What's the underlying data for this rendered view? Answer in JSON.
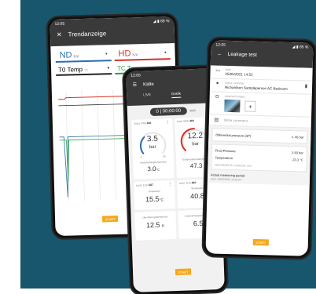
{
  "colors": {
    "background_panel": "#17566d",
    "accent_orange": "#f6a81c",
    "appbar_dark": "#3a3a3a",
    "nd_blue": "#2b6cb0",
    "hd_red": "#d93025",
    "tc_green": "#25a244"
  },
  "phone1": {
    "status_time": "12:05",
    "status_icons": "◢ ▮ 85 %",
    "close_icon": "✕",
    "title": "Trendanzeige",
    "selectors": [
      {
        "name": "ND",
        "unit": "bar",
        "arrow": "▾"
      },
      {
        "name": "HD",
        "unit": "bar",
        "arrow": "▾"
      }
    ],
    "selectors2": [
      {
        "name": "T0 Temp",
        "unit": "°C",
        "arrow": "▾"
      },
      {
        "name": "TC T",
        "unit": "",
        "arrow": ""
      }
    ],
    "start_label": "START"
  },
  "phone2": {
    "status_time": "12:05",
    "menu_icon": "☰",
    "title": "Kälte",
    "tabs": [
      "LIVE",
      "Grafik",
      ""
    ],
    "timer": "0 | 00:00:00",
    "timer_unit": "Std:h",
    "cards_gauge": [
      {
        "header": "testo 549i",
        "id": "460",
        "value": "3.5",
        "unit": "bar",
        "min": "0",
        "max": "50",
        "caption": "Verdampfungstemperatur",
        "temp": "3.0",
        "temp_unit": "°C",
        "menu": "⋮"
      },
      {
        "header": "testo 549i",
        "id": "460",
        "value": "12.2",
        "unit": "bar",
        "min": "",
        "max": "",
        "caption": "Kondensationstemperatur",
        "temp": "47.3",
        "temp_unit": "",
        "menu": ""
      }
    ],
    "cards_small_hdr": [
      {
        "header": "testo 115i",
        "id": "687",
        "menu": "⋮"
      },
      {
        "header": "testo 115i",
        "id": "460",
        "menu": ""
      }
    ],
    "cards_vals": [
      {
        "caption": "Temperatur",
        "value": "15.5",
        "unit": "°C"
      },
      {
        "caption": "Temperatur",
        "value": "40.8",
        "unit": ""
      },
      {
        "caption": "Überhitzungstemperatur",
        "value": "12.5",
        "unit": "K"
      },
      {
        "caption": "Unterkühlungstemperatur",
        "value": "6.5",
        "unit": ""
      }
    ],
    "start_label": "START"
  },
  "phone3": {
    "status_time": "12:05",
    "status_icons": "◢ ▮ 85 %",
    "back_icon": "←",
    "title": "Leakage test",
    "date_label": "Date",
    "date_value": "25/05/2021 14:52",
    "customer_label": "Add a customer",
    "customer_value": "Richardson Sampleperson AC Bedroom",
    "attach_label": "Attached images",
    "comment_label": "Write comment",
    "diff_label": "Differential pressure (ΔP)",
    "diff_value": "-1.46 bar",
    "final_pressure_label": "Final Pressure",
    "final_pressure_value": "3.93 bar",
    "temperature_label": "Temperature",
    "temperature_value": "23.3 °C",
    "recorded": "RECORDED BY SENSOR:   943",
    "period_label": "Actual measuring period",
    "period_value": "Start: 05/05/2021 14:51:54",
    "start_label": "START"
  }
}
